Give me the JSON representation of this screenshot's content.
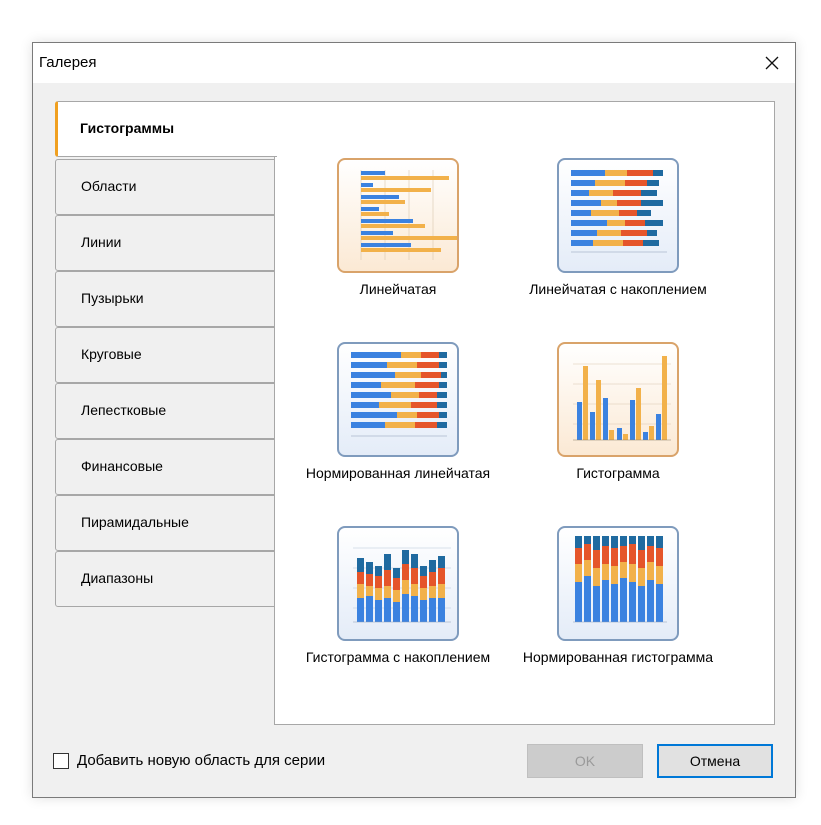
{
  "dialog": {
    "title": "Галерея"
  },
  "tabs": [
    {
      "label": "Гистограммы",
      "active": true
    },
    {
      "label": "Области"
    },
    {
      "label": "Линии"
    },
    {
      "label": "Пузырьки"
    },
    {
      "label": "Круговые"
    },
    {
      "label": "Лепестковые"
    },
    {
      "label": "Финансовые"
    },
    {
      "label": "Пирамидальные"
    },
    {
      "label": "Диапазоны"
    }
  ],
  "charts": [
    {
      "label": "Линейчатая",
      "icon": "bar-chart-icon"
    },
    {
      "label": "Линейчатая с накоплением",
      "icon": "stacked-bar-chart-icon"
    },
    {
      "label": "Нормированная линейчатая",
      "icon": "full-stacked-bar-chart-icon"
    },
    {
      "label": "Гистограмма",
      "icon": "column-chart-icon"
    },
    {
      "label": "Гистограмма с накоплением",
      "icon": "stacked-column-chart-icon"
    },
    {
      "label": "Нормированная гистограмма",
      "icon": "full-stacked-column-chart-icon"
    }
  ],
  "footer": {
    "checkbox_label": "Добавить новую область для серии",
    "ok_label": "OK",
    "cancel_label": "Отмена"
  },
  "colors": {
    "blue": "#3b82e0",
    "orange": "#f2b14a",
    "red": "#e5552a",
    "teal": "#1f6aa0",
    "accent": "#0078d7"
  }
}
